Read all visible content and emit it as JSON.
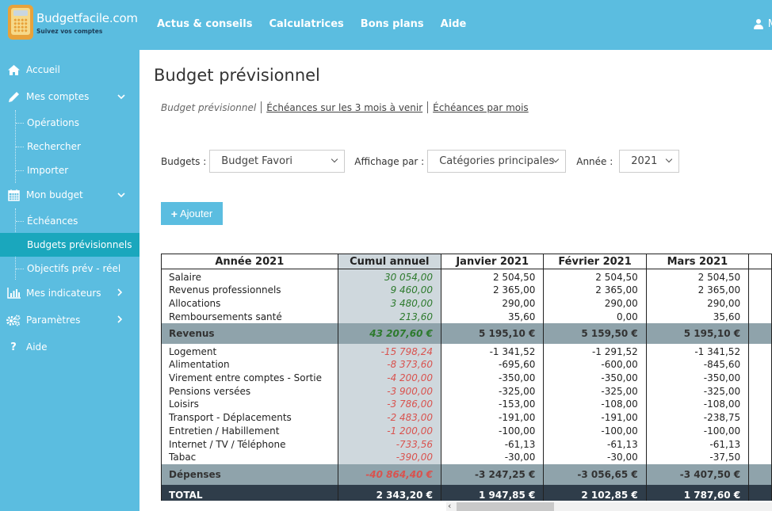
{
  "brand": {
    "name": "Budgetfacile.com",
    "tagline": "Suivez vos comptes"
  },
  "topnav": [
    {
      "label": "Actus & conseils"
    },
    {
      "label": "Calculatrices"
    },
    {
      "label": "Bons plans"
    },
    {
      "label": "Aide"
    }
  ],
  "user": {
    "label": "M",
    "icon": "user-icon"
  },
  "sidebar": {
    "items": [
      {
        "label": "Accueil",
        "icon": "home-icon"
      },
      {
        "label": "Mes comptes",
        "icon": "pencil-icon",
        "expanded": true,
        "children": [
          {
            "label": "Opérations"
          },
          {
            "label": "Rechercher"
          },
          {
            "label": "Importer"
          }
        ]
      },
      {
        "label": "Mon budget",
        "icon": "calendar-icon",
        "expanded": true,
        "children": [
          {
            "label": "Échéances"
          },
          {
            "label": "Budgets prévisionnels",
            "active": true
          },
          {
            "label": "Objectifs prév - réel"
          }
        ]
      },
      {
        "label": "Mes indicateurs",
        "icon": "bar-chart-icon"
      },
      {
        "label": "Paramètres",
        "icon": "gears-icon"
      },
      {
        "label": "Aide",
        "icon": "question-icon"
      }
    ]
  },
  "page": {
    "title": "Budget prévisionnel",
    "subnav": {
      "current": "Budget prévisionnel",
      "links": [
        "Échéances sur les 3 mois à venir",
        "Échéances par mois"
      ]
    },
    "filters": {
      "budgets_label": "Budgets :",
      "budgets_value": "Budget Favori",
      "affichage_label": "Affichage par :",
      "affichage_value": "Catégories principales",
      "annee_label": "Année :",
      "annee_value": "2021"
    },
    "add_button": "Ajouter"
  },
  "table": {
    "headers": [
      "Année 2021",
      "Cumul annuel",
      "Janvier 2021",
      "Février 2021",
      "Mars 2021"
    ],
    "income_rows": [
      {
        "name": "Salaire",
        "cumul": "30 054,00",
        "months": [
          "2 504,50",
          "2 504,50",
          "2 504,50"
        ]
      },
      {
        "name": "Revenus professionnels",
        "cumul": "9 460,00",
        "months": [
          "2 365,00",
          "2 365,00",
          "2 365,00"
        ]
      },
      {
        "name": "Allocations",
        "cumul": "3 480,00",
        "months": [
          "290,00",
          "290,00",
          "290,00"
        ]
      },
      {
        "name": "Remboursements santé",
        "cumul": "213,60",
        "months": [
          "35,60",
          "0,00",
          "35,60"
        ]
      }
    ],
    "income_total": {
      "name": "Revenus",
      "cumul": "43 207,60 €",
      "months": [
        "5 195,10 €",
        "5 159,50 €",
        "5 195,10 €"
      ]
    },
    "expense_rows": [
      {
        "name": "Logement",
        "cumul": "-15 798,24",
        "months": [
          "-1 341,52",
          "-1 291,52",
          "-1 341,52"
        ]
      },
      {
        "name": "Alimentation",
        "cumul": "-8 373,60",
        "months": [
          "-695,60",
          "-600,00",
          "-845,60"
        ]
      },
      {
        "name": "Virement entre comptes - Sortie",
        "cumul": "-4 200,00",
        "months": [
          "-350,00",
          "-350,00",
          "-350,00"
        ]
      },
      {
        "name": "Pensions versées",
        "cumul": "-3 900,00",
        "months": [
          "-325,00",
          "-325,00",
          "-325,00"
        ]
      },
      {
        "name": "Loisirs",
        "cumul": "-3 786,00",
        "months": [
          "-153,00",
          "-108,00",
          "-108,00"
        ]
      },
      {
        "name": "Transport - Déplacements",
        "cumul": "-2 483,00",
        "months": [
          "-191,00",
          "-191,00",
          "-238,75"
        ]
      },
      {
        "name": "Entretien / Habillement",
        "cumul": "-1 200,00",
        "months": [
          "-100,00",
          "-100,00",
          "-100,00"
        ]
      },
      {
        "name": "Internet / TV / Téléphone",
        "cumul": "-733,56",
        "months": [
          "-61,13",
          "-61,13",
          "-61,13"
        ]
      },
      {
        "name": "Tabac",
        "cumul": "-390,00",
        "months": [
          "-30,00",
          "-30,00",
          "-37,50"
        ]
      }
    ],
    "expense_total": {
      "name": "Dépenses",
      "cumul": "-40 864,40 €",
      "months": [
        "-3 247,25 €",
        "-3 056,65 €",
        "-3 407,50 €"
      ]
    },
    "grand_total": {
      "name": "TOTAL",
      "cumul": "2 343,20 €",
      "months": [
        "1 947,85 €",
        "2 102,85 €",
        "1 787,60 €"
      ]
    }
  },
  "colors": {
    "brand_blue": "#5bbde0",
    "active_teal": "#1aa7bd",
    "income_green": "#2d7a2d",
    "expense_red": "#d9534f",
    "subtotal_gray": "#8fa3ab",
    "total_dark": "#2f3d4a"
  }
}
